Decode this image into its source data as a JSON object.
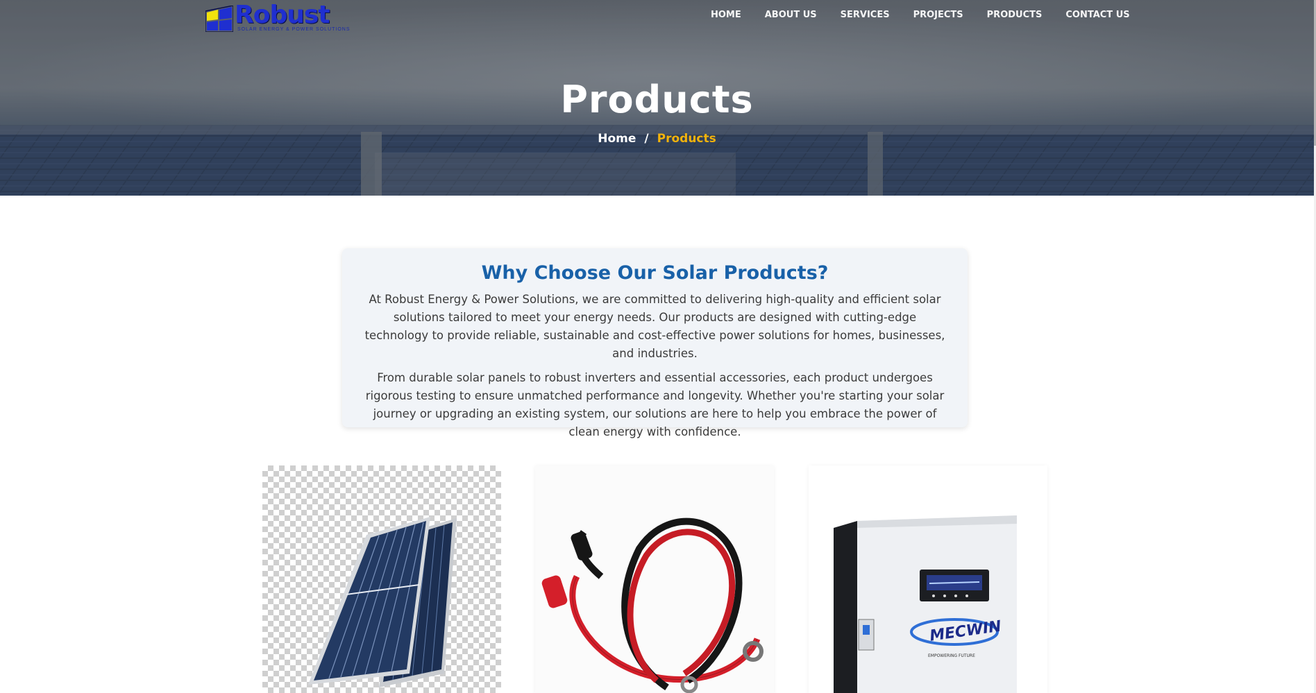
{
  "brand": {
    "name": "Robust",
    "tagline": "SOLAR ENERGY & POWER SOLUTIONS"
  },
  "nav": [
    "HOME",
    "ABOUT US",
    "SERVICES",
    "PROJECTS",
    "PRODUCTS",
    "CONTACT US"
  ],
  "hero": {
    "title": "Products",
    "breadcrumb": {
      "home": "Home",
      "separator": "/",
      "current": "Products"
    }
  },
  "why": {
    "heading": "Why Choose Our Solar Products?",
    "paragraph_1": "At Robust Energy & Power Solutions, we are committed to delivering high-quality and efficient solar solutions tailored to meet your energy needs. Our products are designed with cutting-edge technology to provide reliable, sustainable and cost-effective power solutions for homes, businesses, and industries.",
    "paragraph_2": "From durable solar panels to robust inverters and essential accessories, each product undergoes rigorous testing to ensure unmatched performance and longevity. Whether you're starting your solar journey or upgrading an existing system, our solutions are here to help you embrace the power of clean energy with confidence."
  },
  "products": {
    "inverter_brand": "MECWIN",
    "inverter_slogan": "EMPOWERING FUTURE"
  },
  "colors": {
    "accent": "#f2b20c",
    "heading_blue": "#1961a8",
    "logo_blue": "#1f2fd0"
  }
}
